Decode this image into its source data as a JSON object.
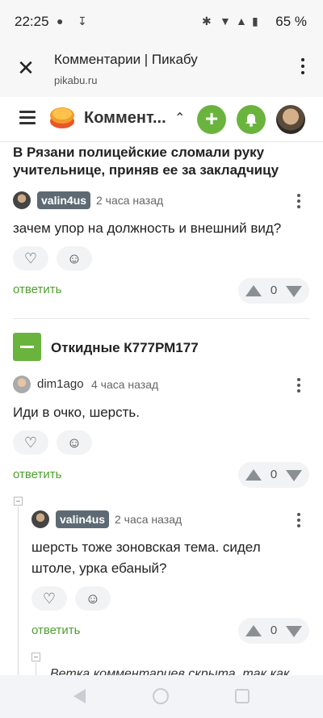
{
  "status_bar": {
    "time": "22:25",
    "battery": "65 %"
  },
  "browser": {
    "title": "Комментарии | Пикабу",
    "url": "pikabu.ru"
  },
  "site_header": {
    "title": "Коммент..."
  },
  "post": {
    "title": "В Рязани полицейские сломали руку учительнице, приняв ее за закладчицу"
  },
  "comments": [
    {
      "author": "valin4us",
      "time": "2 часа назад",
      "text": "зачем упор на должность и внешний вид?",
      "reply_label": "ответить",
      "rating": "0"
    },
    {
      "author": "dim1ago",
      "time": "4 часа назад",
      "text": "Иди в очко, шерсть.",
      "reply_label": "ответить",
      "rating": "0"
    },
    {
      "author": "valin4us",
      "time": "2 часа назад",
      "text_line1": "шерсть тоже зоновская тема. сидел",
      "text_line2": "штоле, урка ебаный?",
      "reply_label": "ответить",
      "rating": "0"
    }
  ],
  "story": {
    "title": "Откидные К777РМ177"
  },
  "hidden_branch": {
    "text": "Ветка комментариев скрыта, так как"
  },
  "icons": {
    "reaction_like": "heart-icon",
    "reaction_emoji": "emoji-add-icon"
  },
  "colors": {
    "accent": "#6ab43e",
    "badge": "#5d6a73",
    "reply": "#4ea02e"
  }
}
